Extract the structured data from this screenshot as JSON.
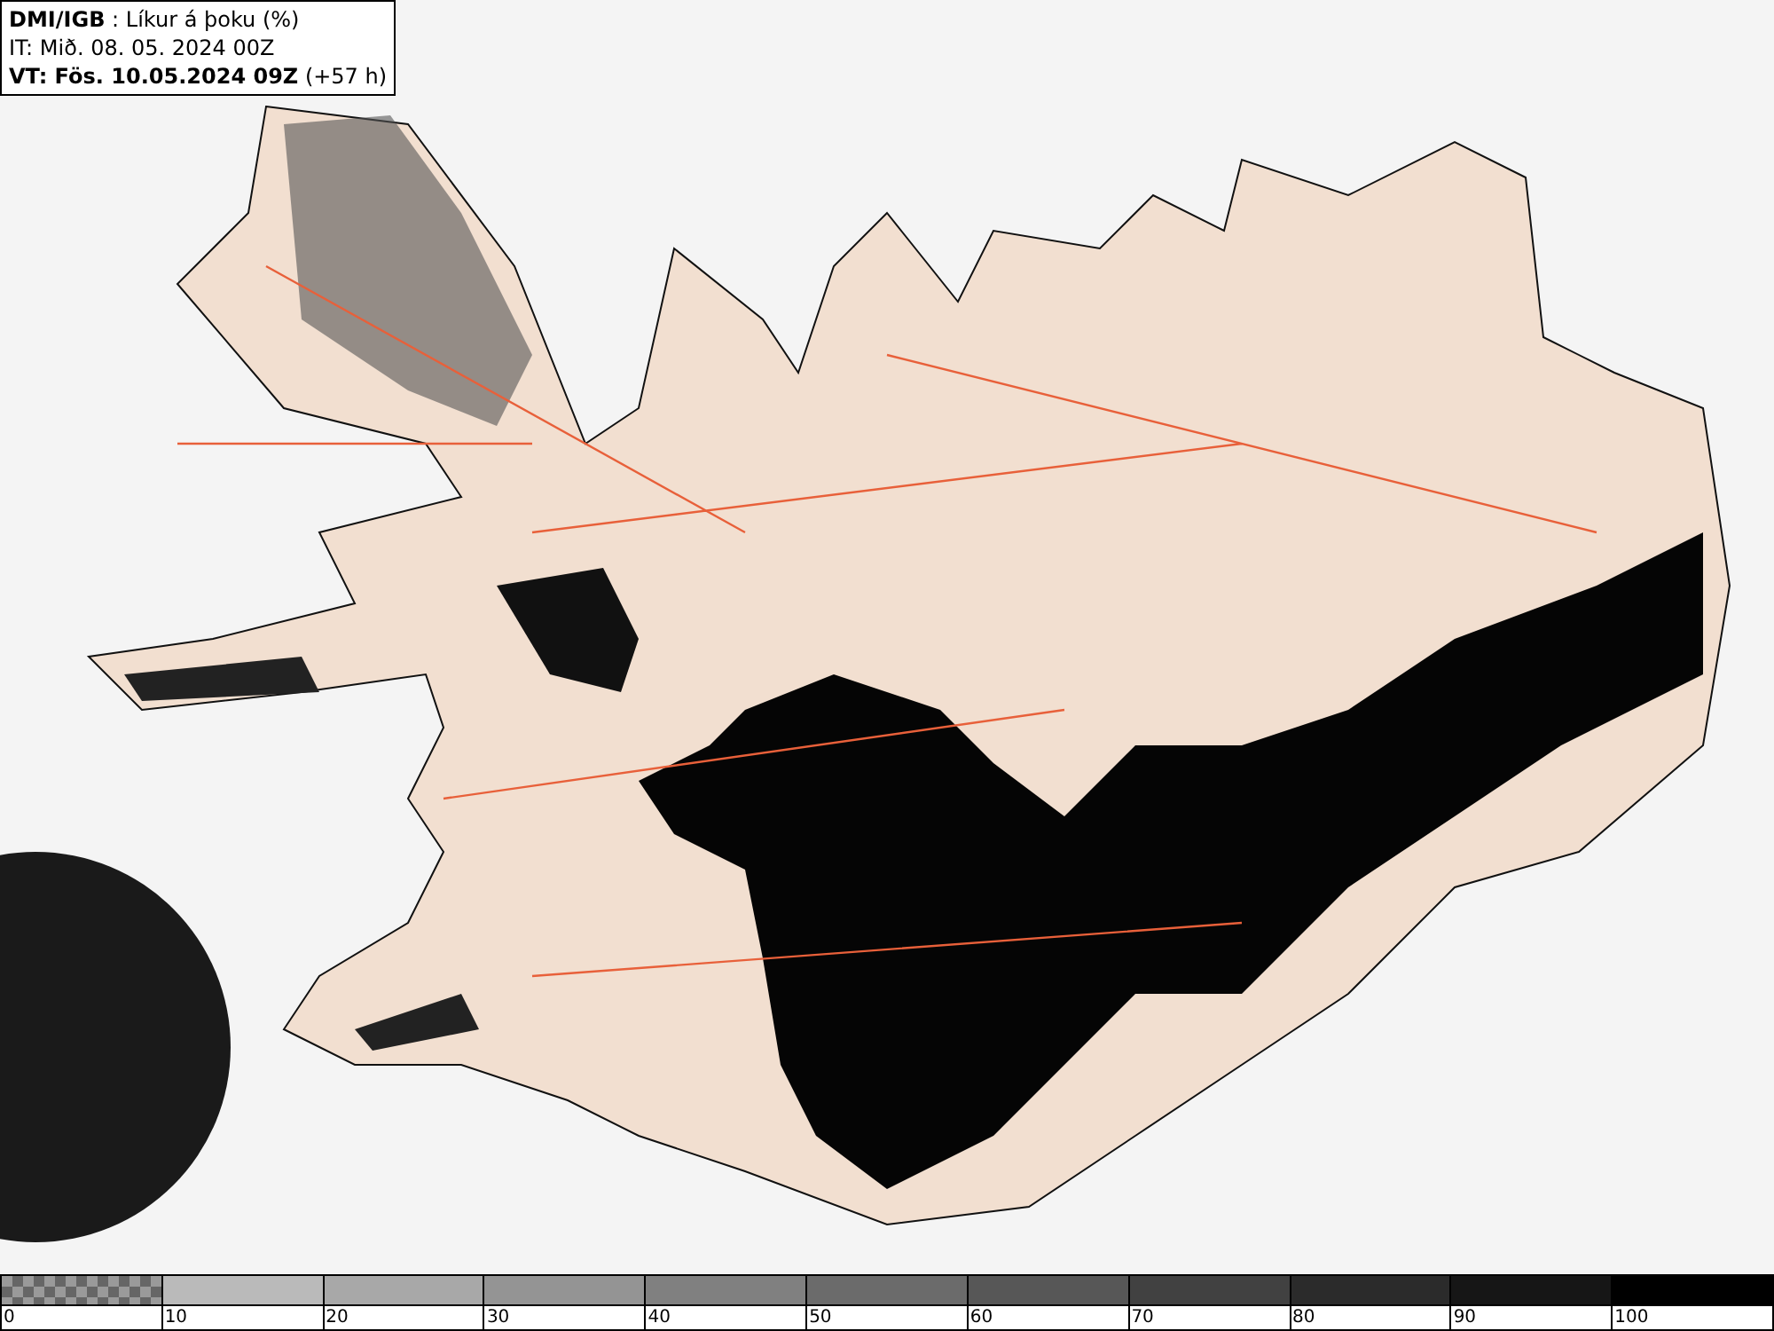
{
  "header": {
    "lines": [
      "**DMI/IGB** : Líkur á þoku (%)",
      "IT: Mið. 08. 05. 2024 00Z",
      "**VT: Fös. 10.05.2024 09Z** (+57 h)"
    ]
  },
  "legend": [
    {
      "kind": "checker",
      "label": "0"
    },
    {
      "kind": "solid",
      "color": "#bababa",
      "label": "10"
    },
    {
      "kind": "solid",
      "color": "#a8a8a8",
      "label": "20"
    },
    {
      "kind": "solid",
      "color": "#949494",
      "label": "30"
    },
    {
      "kind": "solid",
      "color": "#808080",
      "label": "40"
    },
    {
      "kind": "solid",
      "color": "#6b6b6b",
      "label": "50"
    },
    {
      "kind": "solid",
      "color": "#575757",
      "label": "60"
    },
    {
      "kind": "solid",
      "color": "#414141",
      "label": "70"
    },
    {
      "kind": "solid",
      "color": "#2b2b2b",
      "label": "80"
    },
    {
      "kind": "solid",
      "color": "#161616",
      "label": "90"
    },
    {
      "kind": "solid",
      "color": "#000000",
      "label": "100"
    }
  ]
}
